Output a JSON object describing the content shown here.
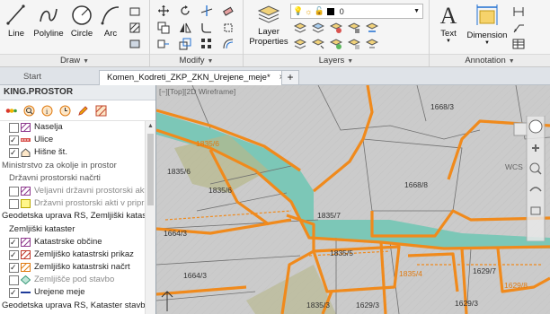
{
  "ribbon": {
    "draw": {
      "title": "Draw",
      "line": "Line",
      "polyline": "Polyline",
      "circle": "Circle",
      "arc": "Arc"
    },
    "modify": {
      "title": "Modify"
    },
    "layers": {
      "title": "Layers",
      "layer_properties_line1": "Layer",
      "layer_properties_line2": "Properties",
      "current_layer": "0"
    },
    "annotation": {
      "title": "Annotation",
      "text": "Text",
      "dimension": "Dimension"
    }
  },
  "tabs": {
    "start": "Start",
    "drawing": "Komen_Kodreti_ZKP_ZKN_Urejene_meje*",
    "close": "×",
    "add": "+"
  },
  "panel": {
    "title": "KING.PROSTOR",
    "items": [
      {
        "label": "Naselja",
        "checked": false,
        "icon": "hatch-icon"
      },
      {
        "label": "Ulice",
        "checked": true,
        "icon": "street-icon"
      },
      {
        "label": "Hišne št.",
        "checked": true,
        "icon": "house-icon"
      },
      {
        "label": "Ministrstvo za okolje in prostor"
      },
      {
        "label": "Državni prostorski načrti"
      },
      {
        "label": "Veljavni državni prostorski akti",
        "checked": false,
        "icon": "hatch-icon"
      },
      {
        "label": "Državni prostorski akti v pripravi",
        "checked": false,
        "icon": "yellow-square-icon"
      },
      {
        "label": "Geodetska uprava RS, Zemljiški kataster"
      },
      {
        "label": "Zemljiški kataster"
      },
      {
        "label": "Katastrske občine",
        "checked": true,
        "icon": "hatch-icon"
      },
      {
        "label": "Zemljiško katastrski prikaz",
        "checked": true,
        "icon": "hatch-icon"
      },
      {
        "label": "Zemljiško katastrski načrt",
        "checked": true,
        "icon": "hatch-icon"
      },
      {
        "label": "Zemljišče pod stavbo",
        "checked": false,
        "icon": "diamond-icon"
      },
      {
        "label": "Urejene meje",
        "checked": true,
        "icon": "line-icon"
      },
      {
        "label": "Geodetska uprava RS, Kataster stavb"
      }
    ]
  },
  "viewport": {
    "label": "[−][Top][2D Wireframe]",
    "wcs": "WCS"
  },
  "parcels": [
    "1668/3",
    "1835/6",
    "1835/6",
    "1835/6",
    "1668/8",
    "1835/7",
    "1664/3",
    "1835/5",
    "1835/4",
    "1629/7",
    "1629/8",
    "1664/3",
    "1835/3",
    "1629/3",
    "1629/3"
  ],
  "colors": {
    "accent_orange": "#f08a1c",
    "teal": "#6fc7b4"
  }
}
